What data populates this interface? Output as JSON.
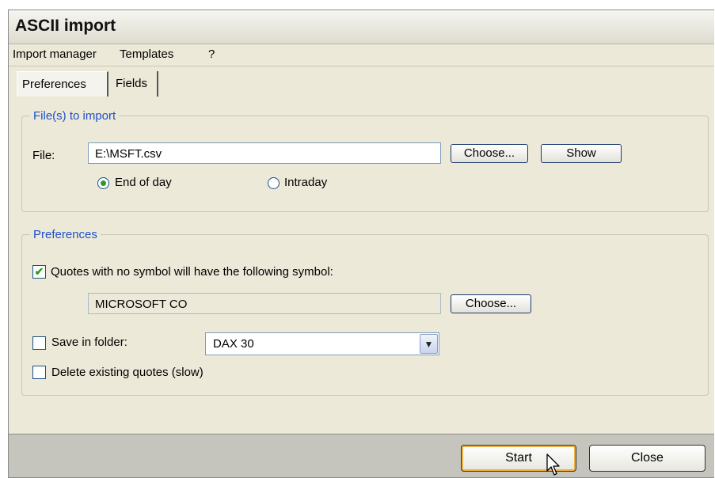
{
  "window": {
    "title": "ASCII import"
  },
  "menu": {
    "items": [
      "Import manager",
      "Templates",
      "?"
    ]
  },
  "tabs": [
    {
      "label": "Preferences"
    },
    {
      "label": "Fields"
    }
  ],
  "files_group": {
    "legend": "File(s) to import",
    "file_label": "File:",
    "file_value": "E:\\MSFT.csv",
    "choose_label": "Choose...",
    "show_label": "Show",
    "radio_eod": "End of day",
    "radio_intraday": "Intraday",
    "selected": "End of day"
  },
  "prefs_group": {
    "legend": "Preferences",
    "quotes_checkbox_label": "Quotes with no symbol will have the following symbol:",
    "quotes_checked": true,
    "symbol_value": "MICROSOFT CO",
    "choose_label": "Choose...",
    "save_folder_label": "Save in folder:",
    "save_folder_checked": false,
    "folder_value": "DAX 30",
    "delete_label": "Delete existing quotes (slow)",
    "delete_checked": false
  },
  "footer": {
    "start_label": "Start",
    "close_label": "Close"
  },
  "icons": {
    "checkmark": "✔",
    "dropdown_arrow": "▼",
    "cursor": "arrow-cursor"
  }
}
